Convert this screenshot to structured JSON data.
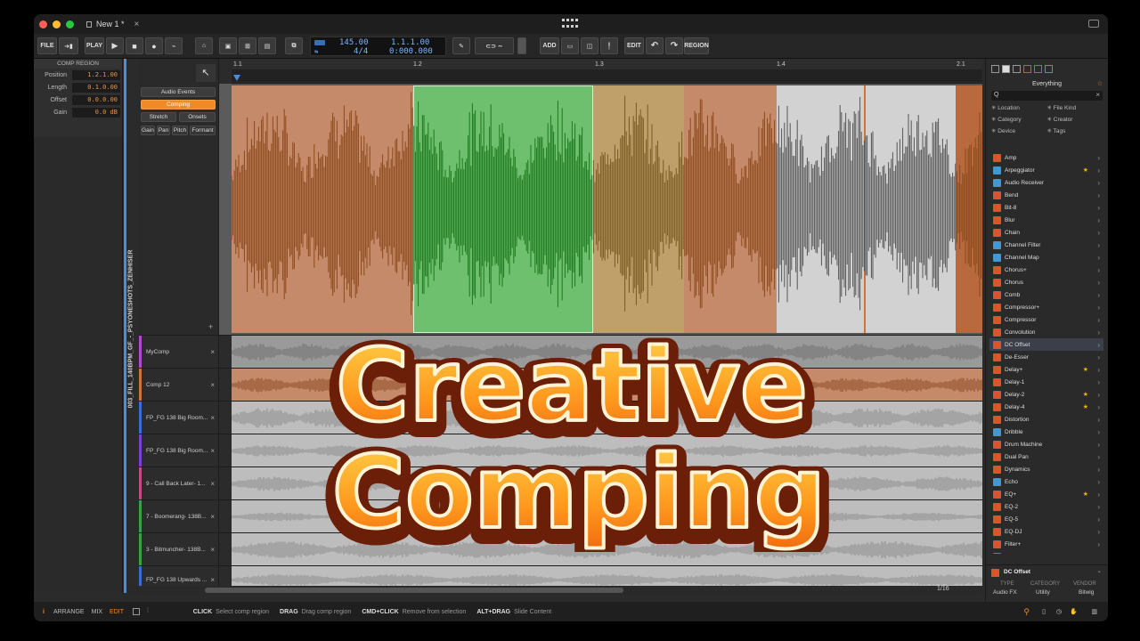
{
  "window": {
    "tab_title": "New 1 *",
    "tab_close": "×"
  },
  "toolbar": {
    "file_label": "FILE",
    "play_label": "PLAY",
    "add_label": "ADD",
    "edit_label": "EDIT",
    "region_label": "REGION",
    "tempo": "145.00",
    "time_sig": "4/4",
    "position_bars": "1.1.1.00",
    "position_time": "0:000.000"
  },
  "comp_region": {
    "title": "COMP REGION",
    "fields": [
      {
        "label": "Position",
        "value": "1.2.1.00"
      },
      {
        "label": "Length",
        "value": "0.1.0.00"
      },
      {
        "label": "Offset",
        "value": "0.0.0.00"
      },
      {
        "label": "Gain",
        "value": "0.0 dB"
      }
    ]
  },
  "track": {
    "vertical_name": "003_FILL_140BPM_GF_-_PSYONESHOTS_ZENHISER",
    "buttons": {
      "audio_events": "Audio Events",
      "comping": "Comping",
      "stretch": "Stretch",
      "onsets": "Onsets"
    },
    "params": [
      "Gain",
      "Pan",
      "Pitch",
      "Formant"
    ],
    "add": "+"
  },
  "ruler": {
    "ticks": [
      "1.1",
      "1.2",
      "1.3",
      "1.4",
      "2.1"
    ]
  },
  "lanes": [
    {
      "name": "MyComp",
      "color": "#b04ad0"
    },
    {
      "name": "Comp 12",
      "color": "#c8773a"
    },
    {
      "name": "FP_FG 138 Big Room...",
      "color": "#3f6bd6"
    },
    {
      "name": "FP_FG 138 Big Room...",
      "color": "#7b3fd6"
    },
    {
      "name": "9 - Call Back Later- 1...",
      "color": "#c64a8a"
    },
    {
      "name": "7 - Boomerang- 138B...",
      "color": "#3aa04a"
    },
    {
      "name": "3 - Bitmuncher- 138B...",
      "color": "#3aa04a"
    },
    {
      "name": "FP_FG 138 Upwards ...",
      "color": "#3f6bd6"
    }
  ],
  "lane_close": "×",
  "zoom": "1/16",
  "status": {
    "arrange": "ARRANGE",
    "mix": "MIX",
    "edit": "EDIT",
    "hints": [
      {
        "key": "CLICK",
        "desc": "Select comp region"
      },
      {
        "key": "DRAG",
        "desc": "Drag comp region"
      },
      {
        "key": "CMD+CLICK",
        "desc": "Remove from selection"
      },
      {
        "key": "ALT+DRAG",
        "desc": "Slide Content"
      }
    ]
  },
  "browser": {
    "title": "Everything",
    "search_prefix": "Q",
    "filters": [
      "Location",
      "File Kind",
      "Category",
      "Creator",
      "Device",
      "Tags"
    ],
    "items": [
      {
        "name": "Amp",
        "icon": "#d9562a",
        "star": false
      },
      {
        "name": "Arpeggiator",
        "icon": "#3d9ad6",
        "star": true
      },
      {
        "name": "Audio Receiver",
        "icon": "#3d9ad6",
        "star": false
      },
      {
        "name": "Bend",
        "icon": "#d9562a",
        "star": false
      },
      {
        "name": "Bit-8",
        "icon": "#d9562a",
        "star": false
      },
      {
        "name": "Blur",
        "icon": "#d9562a",
        "star": false
      },
      {
        "name": "Chain",
        "icon": "#d9562a",
        "star": false
      },
      {
        "name": "Channel Filter",
        "icon": "#3d9ad6",
        "star": false
      },
      {
        "name": "Channel Map",
        "icon": "#3d9ad6",
        "star": false
      },
      {
        "name": "Chorus+",
        "icon": "#d9562a",
        "star": false
      },
      {
        "name": "Chorus",
        "icon": "#d9562a",
        "star": false
      },
      {
        "name": "Comb",
        "icon": "#d9562a",
        "star": false
      },
      {
        "name": "Compressor+",
        "icon": "#d9562a",
        "star": false
      },
      {
        "name": "Compressor",
        "icon": "#d9562a",
        "star": false
      },
      {
        "name": "Convolution",
        "icon": "#d9562a",
        "star": false
      },
      {
        "name": "DC Offset",
        "icon": "#d9562a",
        "star": false,
        "selected": true
      },
      {
        "name": "De-Esser",
        "icon": "#d9562a",
        "star": false
      },
      {
        "name": "Delay+",
        "icon": "#d9562a",
        "star": true
      },
      {
        "name": "Delay-1",
        "icon": "#d9562a",
        "star": false
      },
      {
        "name": "Delay-2",
        "icon": "#d9562a",
        "star": true
      },
      {
        "name": "Delay-4",
        "icon": "#d9562a",
        "star": true
      },
      {
        "name": "Distortion",
        "icon": "#d9562a",
        "star": false
      },
      {
        "name": "Dribble",
        "icon": "#3d9ad6",
        "star": false
      },
      {
        "name": "Drum Machine",
        "icon": "#d9562a",
        "star": false
      },
      {
        "name": "Dual Pan",
        "icon": "#d9562a",
        "star": false
      },
      {
        "name": "Dynamics",
        "icon": "#d9562a",
        "star": false
      },
      {
        "name": "Echo",
        "icon": "#3d9ad6",
        "star": false
      },
      {
        "name": "EQ+",
        "icon": "#d9562a",
        "star": true
      },
      {
        "name": "EQ-2",
        "icon": "#d9562a",
        "star": false
      },
      {
        "name": "EQ-5",
        "icon": "#d9562a",
        "star": false
      },
      {
        "name": "EQ-DJ",
        "icon": "#d9562a",
        "star": false
      },
      {
        "name": "Filter+",
        "icon": "#d9562a",
        "star": false
      },
      {
        "name": "Filter",
        "icon": "#d9562a",
        "star": false
      }
    ],
    "info": {
      "name": "DC Offset",
      "type_label": "TYPE",
      "type_value": "Audio FX",
      "category_label": "CATEGORY",
      "category_value": "Utility",
      "vendor_label": "VENDOR",
      "vendor_value": "Bitwig"
    }
  },
  "overlay": {
    "line1": "Creative",
    "line2": "Comping"
  },
  "colors": {
    "accent": "#f08a24",
    "selection": "#6ebf6e",
    "segment_brown": "#c58a6a",
    "segment_olive": "#bfa06a",
    "segment_gray": "#d2d2d2"
  }
}
